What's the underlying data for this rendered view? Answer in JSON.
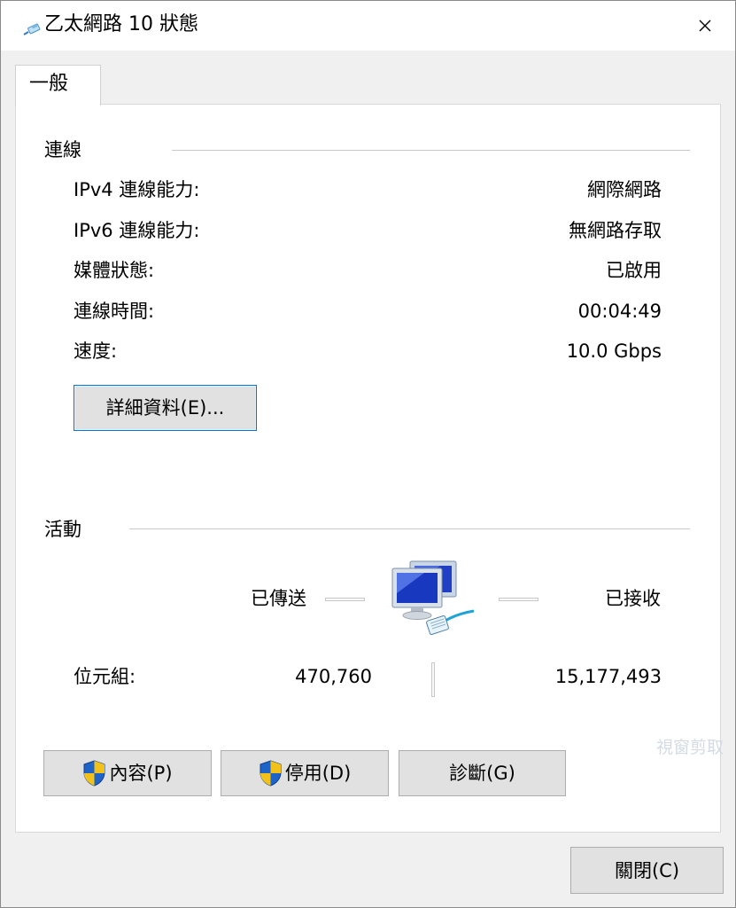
{
  "window": {
    "title": "乙太網路 10 狀態",
    "close_icon": "close-icon"
  },
  "tabs": [
    {
      "label": "一般",
      "selected": true
    }
  ],
  "connection": {
    "group_label": "連線",
    "rows": [
      {
        "label": "IPv4 連線能力:",
        "value": "網際網路"
      },
      {
        "label": "IPv6 連線能力:",
        "value": "無網路存取"
      },
      {
        "label": "媒體狀態:",
        "value": "已啟用"
      },
      {
        "label": "連線時間:",
        "value": "00:04:49"
      },
      {
        "label": "速度:",
        "value": "10.0 Gbps"
      }
    ],
    "details_button": "詳細資料(E)..."
  },
  "activity": {
    "group_label": "活動",
    "sent_label": "已傳送",
    "received_label": "已接收",
    "network_icon": "network-computers-icon",
    "bytes_label": "位元組:",
    "bytes_sent": "470,760",
    "bytes_received": "15,177,493"
  },
  "actions": {
    "properties_button": "內容(P)",
    "disable_button": "停用(D)",
    "diagnose_button": "診斷(G)",
    "shield_icon": "uac-shield-icon"
  },
  "footer": {
    "close_button": "關閉(C)"
  },
  "watermark_text": "視窗剪取",
  "colors": {
    "window_bg": "#f0f0f0",
    "panel_bg": "#ffffff",
    "button_bg": "#e1e1e1",
    "focus_border": "#0078d7",
    "separator": "#c8c8c8"
  }
}
